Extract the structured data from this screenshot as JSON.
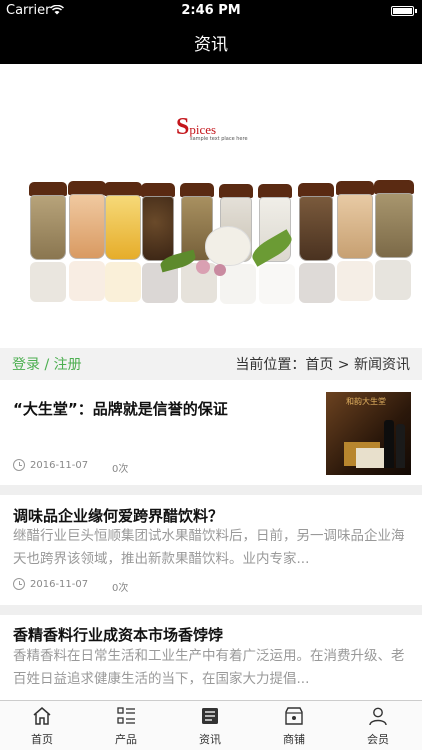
{
  "status_bar": {
    "carrier": "Carrier",
    "time": "2:46 PM"
  },
  "nav": {
    "title": "资讯"
  },
  "banner": {
    "logo_initial": "S",
    "logo_text": "pices",
    "logo_subtitle": "sample text place here"
  },
  "breadcrumb": {
    "login_label": "登录 / 注册",
    "location_text": "当前位置：首页 > 新闻资讯"
  },
  "news": [
    {
      "title": "“大生堂”：品牌就是信誉的保证",
      "description": "",
      "date": "2016-11-07",
      "views": "0次",
      "thumbnail_text": "和韵大生堂"
    },
    {
      "title": "调味品企业缘何爱跨界醋饮料？",
      "description": "继醋行业巨头恒顺集团试水果醋饮料后，日前，另一调味品企业海天也跨界该领域，推出新款果醋饮料。业内专家...",
      "date": "2016-11-07",
      "views": "0次"
    },
    {
      "title": "香精香料行业成资本市场香饽饽",
      "description": "香精香料在日常生活和工业生产中有着广泛运用。在消费升级、老百姓日益追求健康生活的当下，在国家大力提倡..."
    }
  ],
  "tabs": [
    {
      "label": "首页",
      "icon": "home-icon"
    },
    {
      "label": "产品",
      "icon": "list-icon"
    },
    {
      "label": "资讯",
      "icon": "news-icon"
    },
    {
      "label": "商铺",
      "icon": "store-icon"
    },
    {
      "label": "会员",
      "icon": "user-icon"
    }
  ],
  "colors": {
    "accent_green": "#4caf50",
    "logo_red": "#c4161c",
    "nav_background": "#000000"
  }
}
